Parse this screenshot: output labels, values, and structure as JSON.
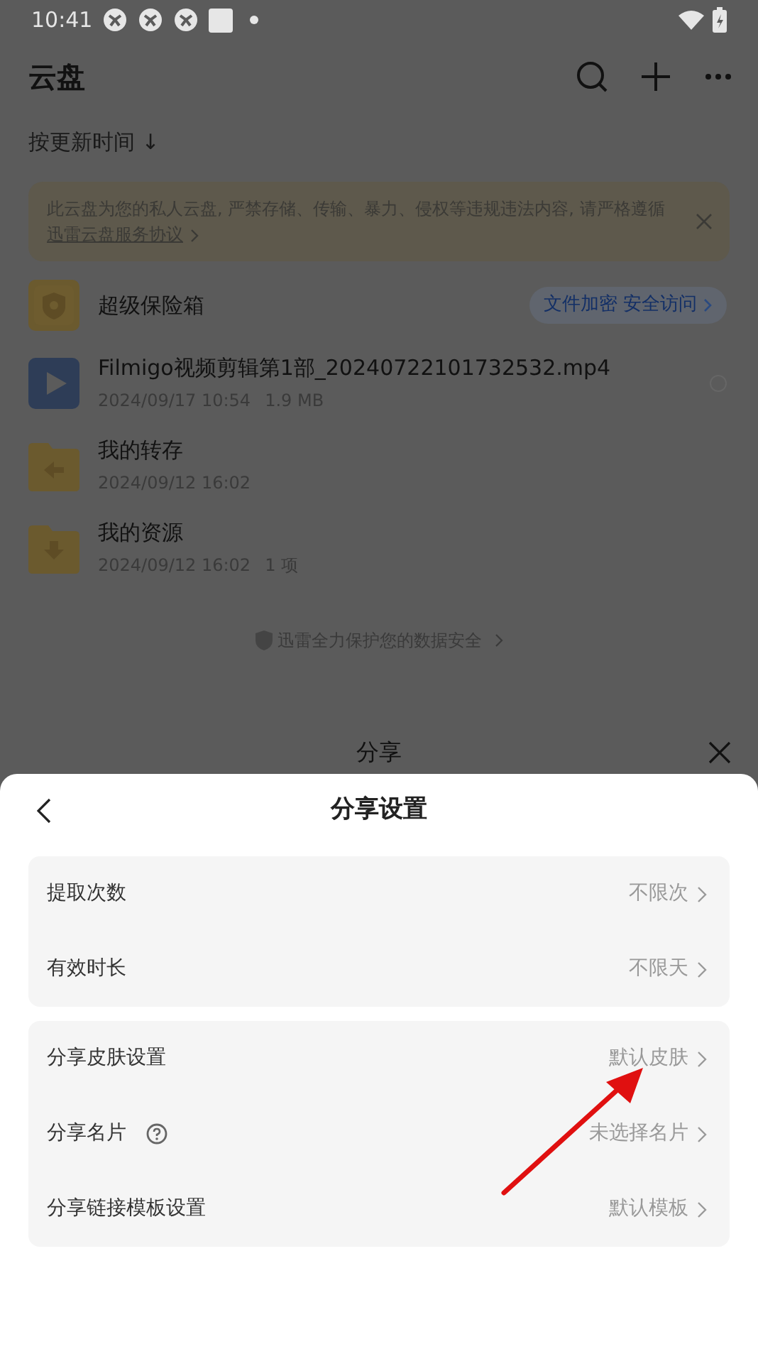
{
  "status_bar": {
    "time": "10:41"
  },
  "header": {
    "title": "云盘",
    "sort_label": "按更新时间 ↓"
  },
  "notice": {
    "text": "此云盘为您的私人云盘, 严禁存储、传输、暴力、侵权等违规违法内容, 请严格遵循",
    "link": "迅雷云盘服务协议"
  },
  "files": [
    {
      "kind": "vault",
      "name": "超级保险箱",
      "badge": "文件加密 安全访问"
    },
    {
      "kind": "video",
      "name": "Filmigo视频剪辑第1部_20240722101732532.mp4",
      "meta": [
        "2024/09/17 10:54",
        "1.9 MB"
      ],
      "selected": false
    },
    {
      "kind": "folder-transfer",
      "name": "我的转存",
      "meta": [
        "2024/09/12 16:02"
      ]
    },
    {
      "kind": "folder-download",
      "name": "我的资源",
      "meta": [
        "2024/09/12 16:02",
        "1 项"
      ]
    }
  ],
  "footer": "迅雷全力保护您的数据安全",
  "share_title": "分享",
  "settings": {
    "title": "分享设置",
    "groups": [
      [
        {
          "label": "提取次数",
          "value": "不限次",
          "help": false
        },
        {
          "label": "有效时长",
          "value": "不限天",
          "help": false
        }
      ],
      [
        {
          "label": "分享皮肤设置",
          "value": "默认皮肤",
          "help": false
        },
        {
          "label": "分享名片",
          "value": "未选择名片",
          "help": true
        },
        {
          "label": "分享链接模板设置",
          "value": "默认模板",
          "help": false
        }
      ]
    ]
  }
}
